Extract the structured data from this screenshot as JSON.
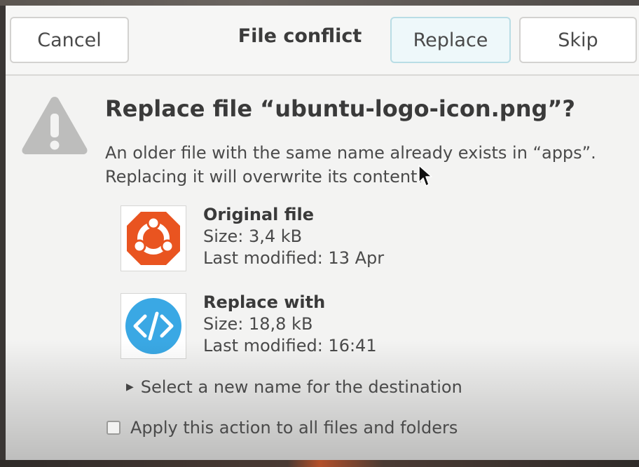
{
  "header": {
    "title": "File conflict",
    "cancel_label": "Cancel",
    "replace_label": "Replace",
    "skip_label": "Skip"
  },
  "message": {
    "heading": "Replace file “ubuntu-logo-icon.png”?",
    "line1": "An older file with the same name already exists in “apps”.",
    "line2": "Replacing it will overwrite its content."
  },
  "original_file": {
    "title": "Original file",
    "size": "Size: 3,4 kB",
    "modified": "Last modified: 13 Apr",
    "icon": "ubuntu-logo-icon"
  },
  "replacement_file": {
    "title": "Replace with",
    "size": "Size: 18,8 kB",
    "modified": "Last modified: 16:41",
    "icon": "code-icon"
  },
  "rename": {
    "label": "Select a new name for the destination"
  },
  "apply_all": {
    "label": "Apply this action to all files and folders",
    "checked": false
  },
  "colors": {
    "ubuntu_orange": "#e95420",
    "code_blue": "#3aa8e4",
    "warning_grey": "#bdbdbc",
    "replace_button_bg": "#eef8fa"
  }
}
